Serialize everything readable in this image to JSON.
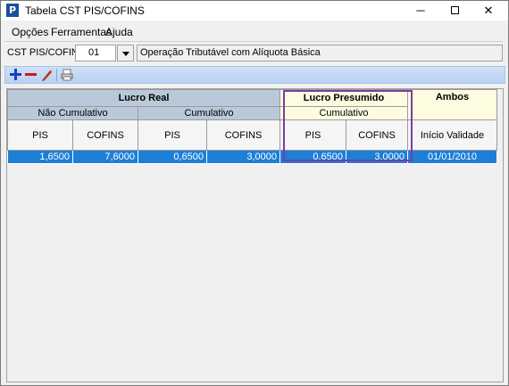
{
  "window": {
    "title": "Tabela CST PIS/COFINS",
    "icon": "app-p-icon",
    "controls": {
      "minimize": "─",
      "close": "✕"
    }
  },
  "menu": {
    "items": [
      "Opções",
      "Ferramentas",
      "Ajuda"
    ]
  },
  "cst": {
    "label": "CST PIS/COFINS:",
    "value": "01",
    "description": "Operação Tributável com Alíquota Básica"
  },
  "toolbar": {
    "buttons": [
      "add-icon",
      "remove-icon",
      "edit-icon",
      "print-icon"
    ]
  },
  "grid": {
    "groups": {
      "lucro_real": "Lucro Real",
      "lucro_presumido": "Lucro Presumido",
      "ambos": "Ambos"
    },
    "subgroups": {
      "nao_cumulativo": "Não Cumulativo",
      "cumulativo_real": "Cumulativo",
      "cumulativo_presumido": "Cumulativo"
    },
    "columns": [
      "PIS",
      "COFINS",
      "PIS",
      "COFINS",
      "PIS",
      "COFINS",
      "Início Validade"
    ],
    "rows": [
      [
        "1,6500",
        "7,6000",
        "0,6500",
        "3,0000",
        "0.6500",
        "3.0000",
        "01/01/2010"
      ]
    ]
  },
  "colors": {
    "selection": "#1e7fd6",
    "highlight_border": "#7d3aa8",
    "header_blue": "#b9c9d9",
    "header_yellow": "#fdfce0"
  }
}
